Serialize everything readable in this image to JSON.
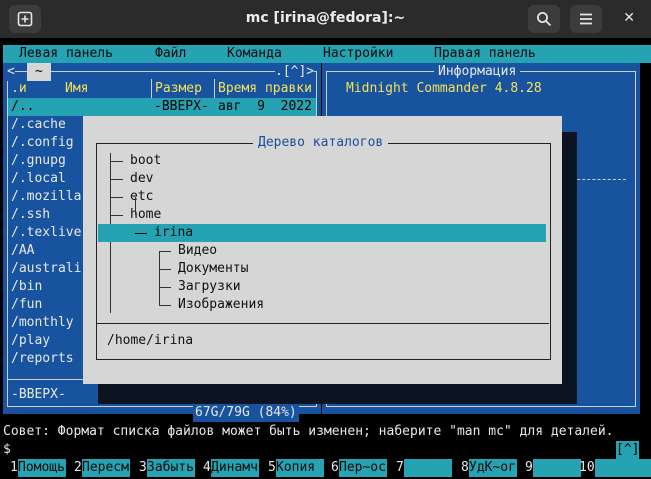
{
  "window": {
    "title": "mc [irina@fedora]:~",
    "new_tab_icon": "plus-square-icon",
    "search_icon": "search-icon",
    "menu_icon": "hamburger-icon",
    "close_label": "✕"
  },
  "menubar": [
    "Левая панель",
    "Файл",
    "Команда",
    "Настройки",
    "Правая панель"
  ],
  "left_panel": {
    "path": "~",
    "header_right": ".[^]>",
    "scroll_indicator": "<",
    "columns": [
      ".и",
      "Имя",
      "Размер",
      "Время правки"
    ],
    "first_row": {
      "name": "/..",
      "size": "-ВВЕРХ-",
      "time": "авг  9  2022"
    },
    "items": [
      "/.cache",
      "/.config",
      "/.gnupg",
      "/.local",
      "/.mozilla",
      "/.ssh",
      "/.texlive",
      "/AA",
      "/australi",
      "/bin",
      "/fun",
      "/monthly",
      "/play",
      "/reports"
    ],
    "status": "-ВВЕРХ-",
    "disk": "67G/79G (84%)"
  },
  "right_panel": {
    "title": "Информация",
    "version": "Midnight Commander 4.8.28",
    "header_right": ".[^]>"
  },
  "tree_dialog": {
    "title": "Дерево каталогов",
    "nodes": [
      {
        "label": "boot",
        "level": 0
      },
      {
        "label": "dev",
        "level": 0
      },
      {
        "label": "etc",
        "level": 0
      },
      {
        "label": "home",
        "level": 0
      },
      {
        "label": "irina",
        "level": 1,
        "selected": true
      },
      {
        "label": "Видео",
        "level": 2
      },
      {
        "label": "Документы",
        "level": 2
      },
      {
        "label": "Загрузки",
        "level": 2
      },
      {
        "label": "Изображения",
        "level": 2
      }
    ],
    "current_path": "/home/irina"
  },
  "hint": "Совет: Формат списка файлов может быть изменен; наберите \"man mc\" для деталей.",
  "prompt": "$",
  "prompt_indicator": "[^]",
  "fkeys": [
    {
      "num": "1",
      "label": "Помощь"
    },
    {
      "num": "2",
      "label": "Пересм"
    },
    {
      "num": "3",
      "label": "Забыть"
    },
    {
      "num": "4",
      "label": "Динамч"
    },
    {
      "num": "5",
      "label": "Копия"
    },
    {
      "num": "6",
      "label": "Пер~ос"
    },
    {
      "num": "7",
      "label": ""
    },
    {
      "num": "8",
      "label": "УдК~ог"
    },
    {
      "num": "9",
      "label": ""
    },
    {
      "num": "10",
      "label": ""
    }
  ],
  "colors": {
    "panel_bg": "#1853a0",
    "accent_cyan": "#25a3b3",
    "header_yellow": "#f5e05a",
    "dialog_bg": "#d6d6d6"
  }
}
